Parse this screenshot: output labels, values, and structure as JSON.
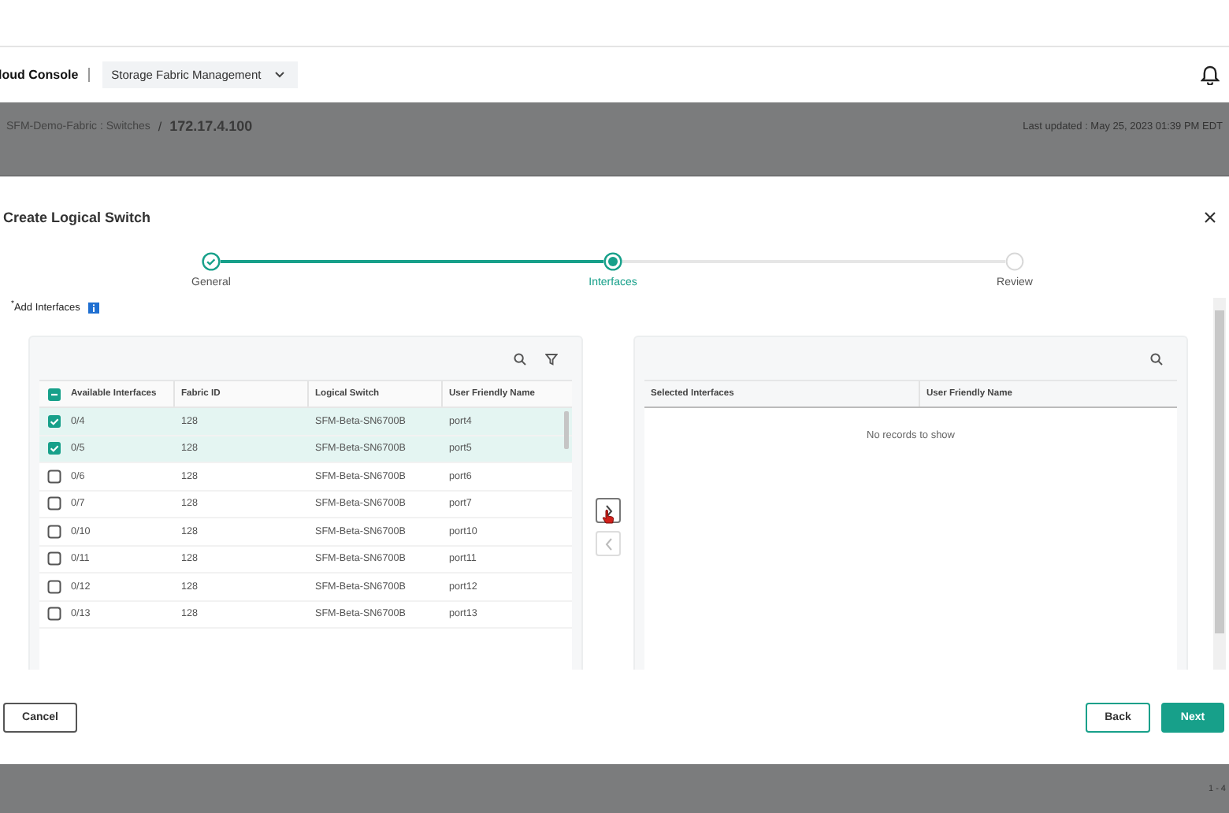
{
  "header": {
    "brand": "loud Console",
    "app_menu": "Storage Fabric Management"
  },
  "breadcrumb": {
    "parent": "SFM-Demo-Fabric : Switches",
    "separator": "/",
    "current": "172.17.4.100",
    "last_updated": "Last updated :  May 25, 2023 01:39 PM EDT"
  },
  "dialog": {
    "title": "Create Logical Switch",
    "steps": [
      {
        "label": "General",
        "done": true,
        "selected": false
      },
      {
        "label": "Interfaces",
        "done": false,
        "selected": true
      },
      {
        "label": "Review",
        "done": false,
        "selected": false
      }
    ],
    "required_mark": "*",
    "field_label": "Add Interfaces",
    "available": {
      "select_all_partial": true,
      "columns": [
        "Available Interfaces",
        "Fabric ID",
        "Logical Switch",
        "User Friendly Name"
      ],
      "rows": [
        {
          "cells": [
            "0/4",
            "128",
            "SFM-Beta-SN6700B",
            "port4"
          ],
          "selected": true
        },
        {
          "cells": [
            "0/5",
            "128",
            "SFM-Beta-SN6700B",
            "port5"
          ],
          "selected": true
        },
        {
          "cells": [
            "0/6",
            "128",
            "SFM-Beta-SN6700B",
            "port6"
          ],
          "selected": false
        },
        {
          "cells": [
            "0/7",
            "128",
            "SFM-Beta-SN6700B",
            "port7"
          ],
          "selected": false
        },
        {
          "cells": [
            "0/10",
            "128",
            "SFM-Beta-SN6700B",
            "port10"
          ],
          "selected": false
        },
        {
          "cells": [
            "0/11",
            "128",
            "SFM-Beta-SN6700B",
            "port11"
          ],
          "selected": false
        },
        {
          "cells": [
            "0/12",
            "128",
            "SFM-Beta-SN6700B",
            "port12"
          ],
          "selected": false
        },
        {
          "cells": [
            "0/13",
            "128",
            "SFM-Beta-SN6700B",
            "port13"
          ],
          "selected": false
        }
      ]
    },
    "transfer_buttons": [
      {
        "kind": "add",
        "disabled": false
      },
      {
        "kind": "remove",
        "disabled": true
      }
    ],
    "selected": {
      "columns": [
        "Selected Interfaces",
        "User Friendly Name"
      ],
      "empty_text": "No records to show"
    },
    "buttons": [
      {
        "label": "Cancel",
        "kind": "secondary"
      },
      {
        "label": "Back",
        "kind": "outline"
      },
      {
        "label": "Next",
        "kind": "primary"
      }
    ]
  },
  "footer": {
    "pagination": "1 - 4"
  }
}
